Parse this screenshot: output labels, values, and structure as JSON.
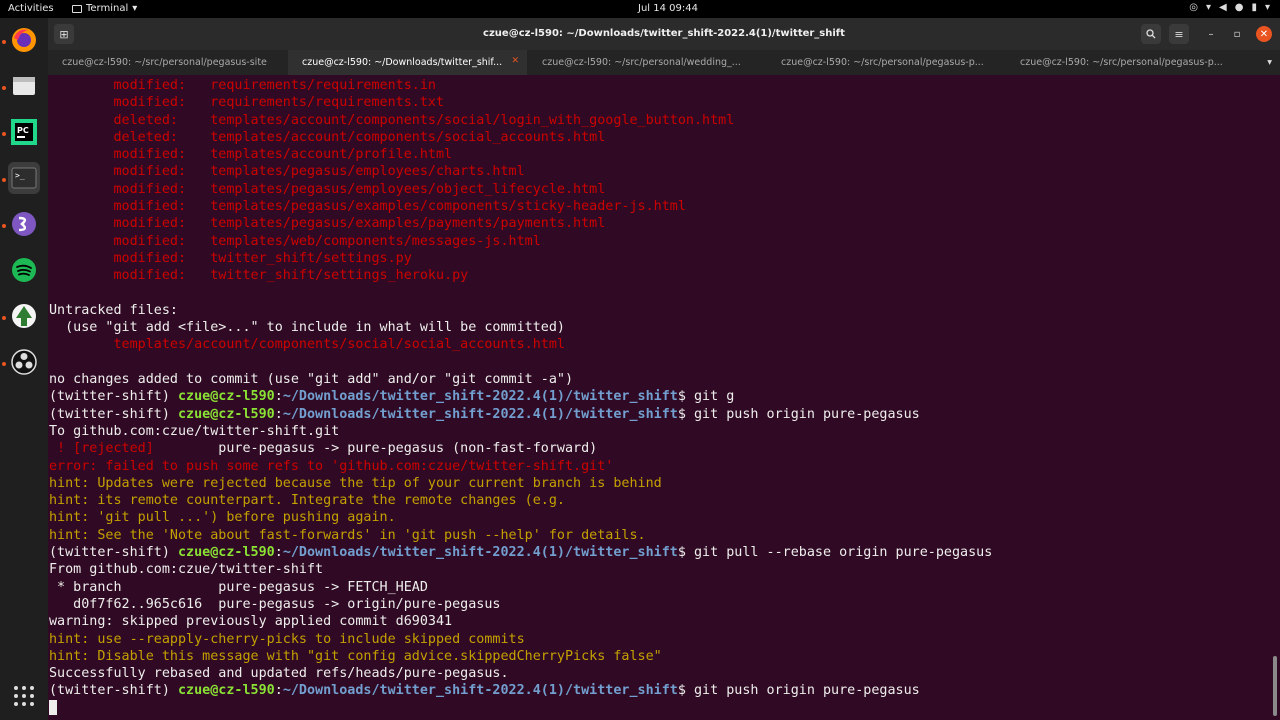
{
  "topbar": {
    "activities": "Activities",
    "app_name": "Terminal",
    "clock": "Jul 14  09:44"
  },
  "window": {
    "title": "czue@cz-l590: ~/Downloads/twitter_shift-2022.4(1)/twitter_shift"
  },
  "tabs": [
    {
      "label": "czue@cz-l590: ~/src/personal/pegasus-site"
    },
    {
      "label": "czue@cz-l590: ~/Downloads/twitter_shif..."
    },
    {
      "label": "czue@cz-l590: ~/src/personal/wedding_..."
    },
    {
      "label": "czue@cz-l590: ~/src/personal/pegasus-p..."
    },
    {
      "label": "czue@cz-l590: ~/src/personal/pegasus-p..."
    }
  ],
  "dock": [
    {
      "name": "firefox-icon"
    },
    {
      "name": "files-icon"
    },
    {
      "name": "pycharm-icon"
    },
    {
      "name": "terminal-icon"
    },
    {
      "name": "emacs-icon"
    },
    {
      "name": "spotify-icon"
    },
    {
      "name": "inkscape-icon"
    },
    {
      "name": "obs-icon"
    }
  ],
  "prompt": {
    "venv": "(twitter-shift) ",
    "user": "czue@cz-l590",
    "colon": ":",
    "path": "~/Downloads/twitter_shift-2022.4(1)/twitter_shift",
    "dollar": "$ "
  },
  "terminal": {
    "changes": [
      {
        "status": "        modified:   ",
        "file": "requirements/requirements.in"
      },
      {
        "status": "        modified:   ",
        "file": "requirements/requirements.txt"
      },
      {
        "status": "        deleted:    ",
        "file": "templates/account/components/social/login_with_google_button.html"
      },
      {
        "status": "        deleted:    ",
        "file": "templates/account/components/social_accounts.html"
      },
      {
        "status": "        modified:   ",
        "file": "templates/account/profile.html"
      },
      {
        "status": "        modified:   ",
        "file": "templates/pegasus/employees/charts.html"
      },
      {
        "status": "        modified:   ",
        "file": "templates/pegasus/employees/object_lifecycle.html"
      },
      {
        "status": "        modified:   ",
        "file": "templates/pegasus/examples/components/sticky-header-js.html"
      },
      {
        "status": "        modified:   ",
        "file": "templates/pegasus/examples/payments/payments.html"
      },
      {
        "status": "        modified:   ",
        "file": "templates/web/components/messages-js.html"
      },
      {
        "status": "        modified:   ",
        "file": "twitter_shift/settings.py"
      },
      {
        "status": "        modified:   ",
        "file": "twitter_shift/settings_heroku.py"
      }
    ],
    "untracked_header": "Untracked files:",
    "untracked_hint": "  (use \"git add <file>...\" to include in what will be committed)",
    "untracked_file": "        templates/account/components/social/social_accounts.html",
    "no_changes": "no changes added to commit (use \"git add\" and/or \"git commit -a\")",
    "cmd1": "git g",
    "cmd2": "git push origin pure-pegasus",
    "push_to": "To github.com:czue/twitter-shift.git",
    "rejected_tag": " ! [rejected]",
    "rejected_rest": "        pure-pegasus -> pure-pegasus (non-fast-forward)",
    "error_line": "error: failed to push some refs to 'github.com:czue/twitter-shift.git'",
    "hints": [
      "hint: Updates were rejected because the tip of your current branch is behind",
      "hint: its remote counterpart. Integrate the remote changes (e.g.",
      "hint: 'git pull ...') before pushing again.",
      "hint: See the 'Note about fast-forwards' in 'git push --help' for details."
    ],
    "cmd3": "git pull --rebase origin pure-pegasus",
    "from_line": "From github.com:czue/twitter-shift",
    "branch_line": " * branch            pure-pegasus -> FETCH_HEAD",
    "update_line": "   d0f7f62..965c616  pure-pegasus -> origin/pure-pegasus",
    "warning_line": "warning: skipped previously applied commit d690341",
    "hints2": [
      "hint: use --reapply-cherry-picks to include skipped commits",
      "hint: Disable this message with \"git config advice.skippedCherryPicks false\""
    ],
    "success_line": "Successfully rebased and updated refs/heads/pure-pegasus.",
    "cmd4": "git push origin pure-pegasus"
  }
}
